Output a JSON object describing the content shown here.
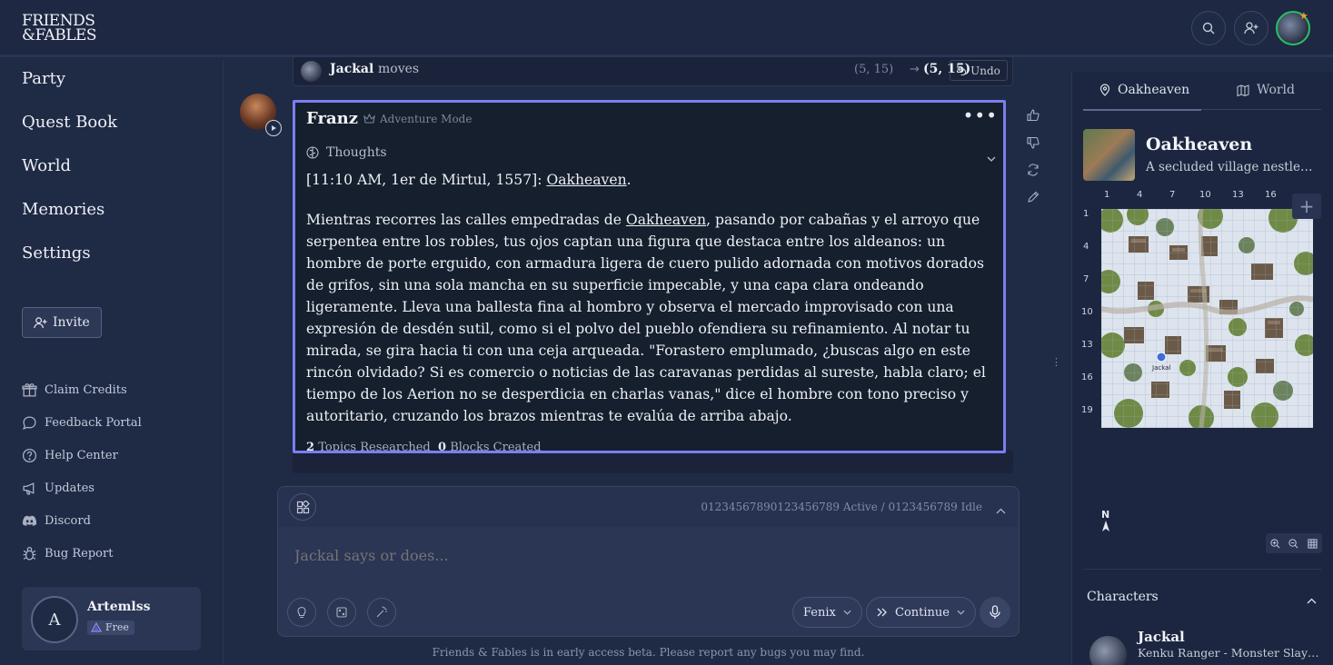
{
  "brand": {
    "line1": "FRIENDS",
    "line2": "&FABLES"
  },
  "nav": {
    "items": [
      "Party",
      "Quest Book",
      "World",
      "Memories",
      "Settings"
    ]
  },
  "sidebar": {
    "invite_label": "Invite",
    "links": [
      "Claim Credits",
      "Feedback Portal",
      "Help Center",
      "Updates",
      "Discord",
      "Bug Report"
    ]
  },
  "user": {
    "initial": "A",
    "name": "Artemlss",
    "plan": "Free"
  },
  "move": {
    "actor": "Jackal",
    "verb": "moves",
    "from": "(5, 15)",
    "arrow": "→",
    "to": "(5, 15)",
    "undo_label": "Undo"
  },
  "message": {
    "speaker": "Franz",
    "mode": "Adventure Mode",
    "thoughts_label": "Thoughts",
    "timestamp_prefix": "[11:10 AM, 1er de Mirtul, 1557]: ",
    "timestamp_link": "Oakheaven",
    "timestamp_suffix": ".",
    "p2_before": "Mientras recorres las calles empedradas de ",
    "p2_link": "Oakheaven",
    "p2_after": ", pasando por cabañas y el arroyo que serpentea entre los robles, tus ojos captan una figura que destaca entre los aldeanos: un hombre de porte erguido, con armadura ligera de cuero pulido adornada con motivos dorados de grifos, sin una sola mancha en su superficie impecable, y una capa clara ondeando ligeramente. Lleva una ballesta fina al hombro y observa el mercado improvisado con una expresión de desdén sutil, como si el polvo del pueblo ofendiera su refinamiento. Al notar tu mirada, se gira hacia ti con una ceja arqueada.  \"Forastero emplumado, ¿buscas algo en este rincón olvidado? Si es comercio o noticias de las caravanas perdidas al sureste, habla claro; el tiempo de los Aerion no se desperdicia en charlas vanas,\"  dice el hombre con tono preciso y autoritario, cruzando los brazos mientras te evalúa de arriba abajo.",
    "topics_count": "2",
    "topics_label": "Topics Researched",
    "blocks_count": "0",
    "blocks_label": "Blocks Created"
  },
  "composer": {
    "status": "0123456789012345 6789 Active / 0123456789 Idle",
    "status_text": "01234567890123456789 Active / 0123456789 Idle",
    "placeholder": "Jackal says or does...",
    "model_label": "Fenix",
    "continue_label": "Continue"
  },
  "footer": "Friends & Fables is in early access beta. Please report any bugs you may find.",
  "right_panel": {
    "tab_location": "Oakheaven",
    "tab_world": "World",
    "location_name": "Oakheaven",
    "location_desc": "A secluded village nestled…",
    "grid_cols": [
      "1",
      "4",
      "7",
      "10",
      "13",
      "16"
    ],
    "grid_rows": [
      "1",
      "4",
      "7",
      "10",
      "13",
      "16",
      "19"
    ],
    "map_token_label": "Jackal",
    "compass": "N",
    "characters_title": "Characters",
    "char_name": "Jackal",
    "char_class": "Kenku Ranger - Monster Slayer …"
  }
}
